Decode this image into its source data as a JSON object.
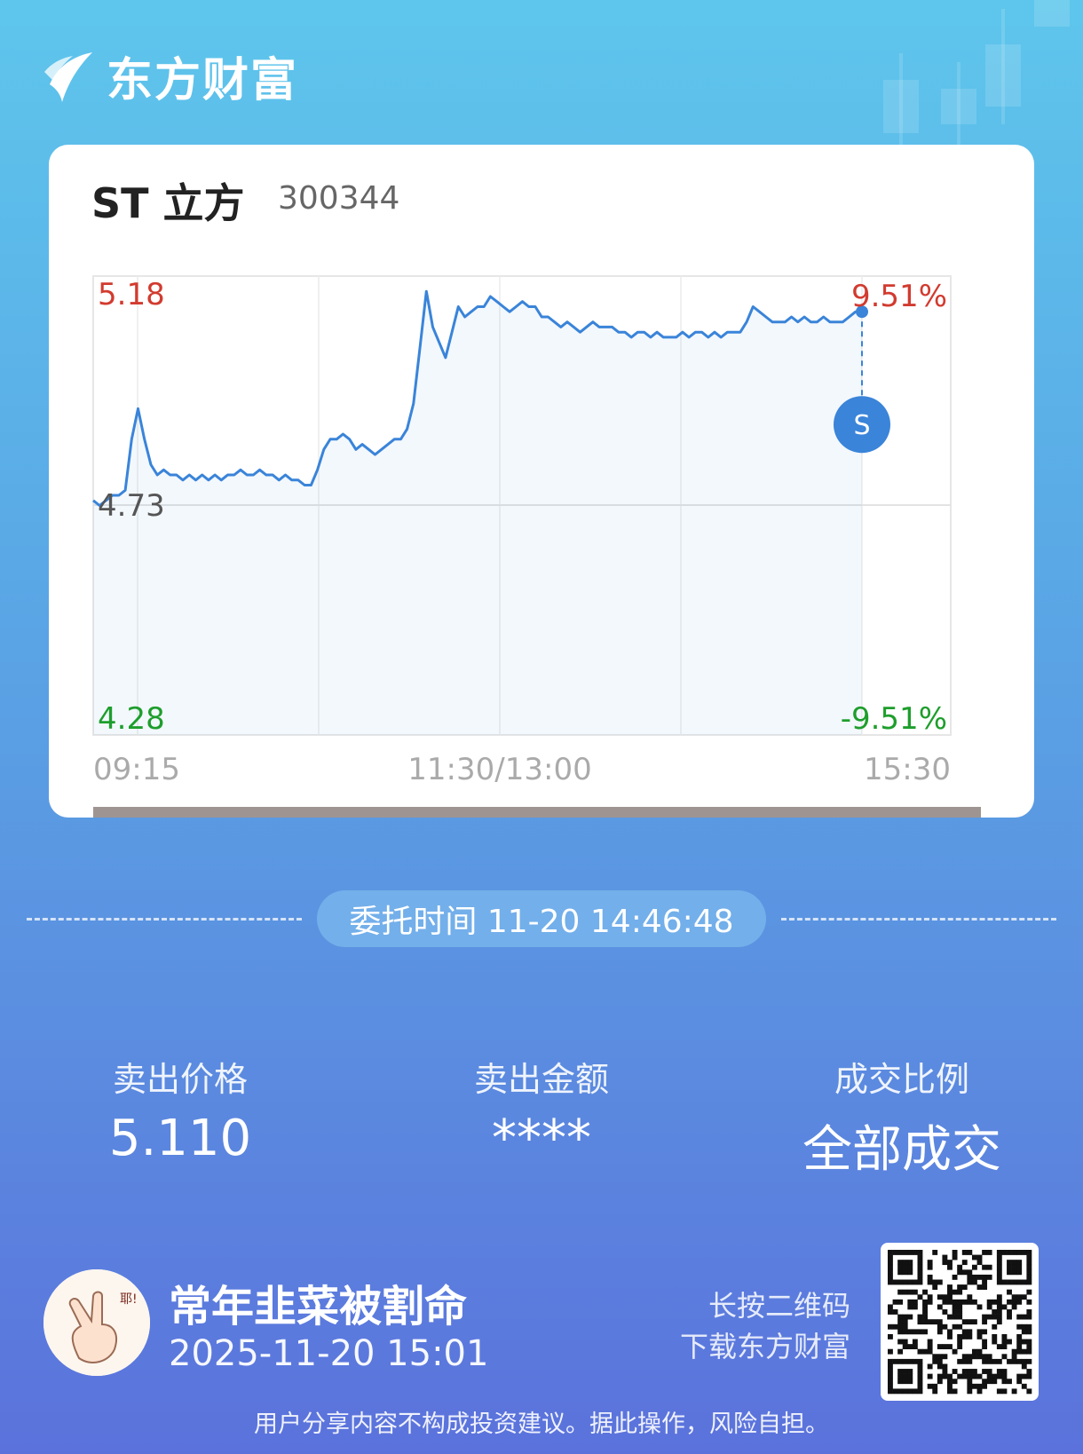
{
  "brand": {
    "name": "东方财富"
  },
  "stock": {
    "name": "ST 立方",
    "code": "300344"
  },
  "chart_data": {
    "type": "line",
    "y_left_labels": {
      "top": "5.18",
      "mid": "4.73",
      "bottom": "4.28"
    },
    "y_right_labels": {
      "top": "9.51%",
      "bottom": "-9.51%"
    },
    "x_labels": [
      "09:15",
      "11:30/13:00",
      "15:30"
    ],
    "ylim": [
      4.28,
      5.18
    ],
    "prev_close": 4.73,
    "x_domain": [
      0,
      240
    ],
    "series": [
      {
        "x": [
          0,
          2,
          4,
          6,
          8,
          10,
          12,
          14,
          16,
          18,
          20,
          22,
          24,
          26,
          28,
          30,
          32,
          34,
          36,
          38,
          40,
          42,
          44,
          46,
          48,
          50,
          52,
          54,
          56,
          58,
          60,
          62,
          64,
          66,
          68,
          70,
          72,
          74,
          76,
          78,
          80,
          82,
          84,
          86,
          88,
          90,
          92,
          94,
          96,
          98,
          100,
          102,
          104,
          106,
          108,
          110,
          112,
          114,
          116,
          118,
          120,
          122,
          124,
          126,
          128,
          130,
          132,
          134,
          136,
          138,
          140,
          142,
          144,
          146,
          148,
          150,
          152,
          154,
          156,
          158,
          160,
          162,
          164,
          166,
          168,
          170,
          172,
          174,
          176,
          178,
          180,
          182,
          184,
          186,
          188,
          190,
          192,
          194,
          196,
          198,
          200,
          202,
          204,
          206,
          208,
          210,
          212,
          214,
          216,
          218,
          220,
          222,
          224,
          226,
          228,
          230,
          232,
          234,
          236,
          238,
          240
        ],
        "y": [
          4.74,
          4.73,
          4.74,
          4.75,
          4.75,
          4.76,
          4.86,
          4.92,
          4.86,
          4.81,
          4.79,
          4.8,
          4.79,
          4.79,
          4.78,
          4.79,
          4.78,
          4.79,
          4.78,
          4.79,
          4.78,
          4.79,
          4.79,
          4.8,
          4.79,
          4.79,
          4.8,
          4.79,
          4.79,
          4.78,
          4.79,
          4.78,
          4.78,
          4.77,
          4.77,
          4.8,
          4.84,
          4.86,
          4.86,
          4.87,
          4.86,
          4.84,
          4.85,
          4.84,
          4.83,
          4.84,
          4.85,
          4.86,
          4.86,
          4.88,
          4.93,
          5.04,
          5.15,
          5.08,
          5.05,
          5.02,
          5.07,
          5.12,
          5.1,
          5.11,
          5.12,
          5.12,
          5.14,
          5.13,
          5.12,
          5.11,
          5.12,
          5.13,
          5.12,
          5.12,
          5.1,
          5.1,
          5.09,
          5.08,
          5.09,
          5.08,
          5.07,
          5.08,
          5.09,
          5.08,
          5.08,
          5.08,
          5.07,
          5.07,
          5.06,
          5.07,
          5.07,
          5.06,
          5.07,
          5.06,
          5.06,
          5.06,
          5.07,
          5.06,
          5.07,
          5.07,
          5.06,
          5.07,
          5.06,
          5.07,
          5.07,
          5.07,
          5.09,
          5.12,
          5.11,
          5.1,
          5.09,
          5.09,
          5.09,
          5.1,
          5.09,
          5.1,
          5.09,
          5.09,
          5.1,
          5.09,
          5.09,
          5.09,
          5.1,
          5.11,
          5.11
        ],
        "end_marker": "S"
      }
    ]
  },
  "commission": {
    "text": "委托时间 11-20 14:46:48"
  },
  "stats": [
    {
      "label": "卖出价格",
      "value": "5.110"
    },
    {
      "label": "卖出金额",
      "value": "****"
    },
    {
      "label": "成交比例",
      "value": "全部成交"
    }
  ],
  "user": {
    "name": "常年韭菜被割命",
    "datetime": "2025-11-20 15:01",
    "avatar_text": "耶!"
  },
  "qr": {
    "line1": "长按二维码",
    "line2": "下载东方财富"
  },
  "disclaimer": "用户分享内容不构成投资建议。据此操作，风险自担。",
  "colors": {
    "up": "#e0312c",
    "down": "#1e9e2c",
    "line": "#3a84d9",
    "accent": "#3a84d9"
  }
}
